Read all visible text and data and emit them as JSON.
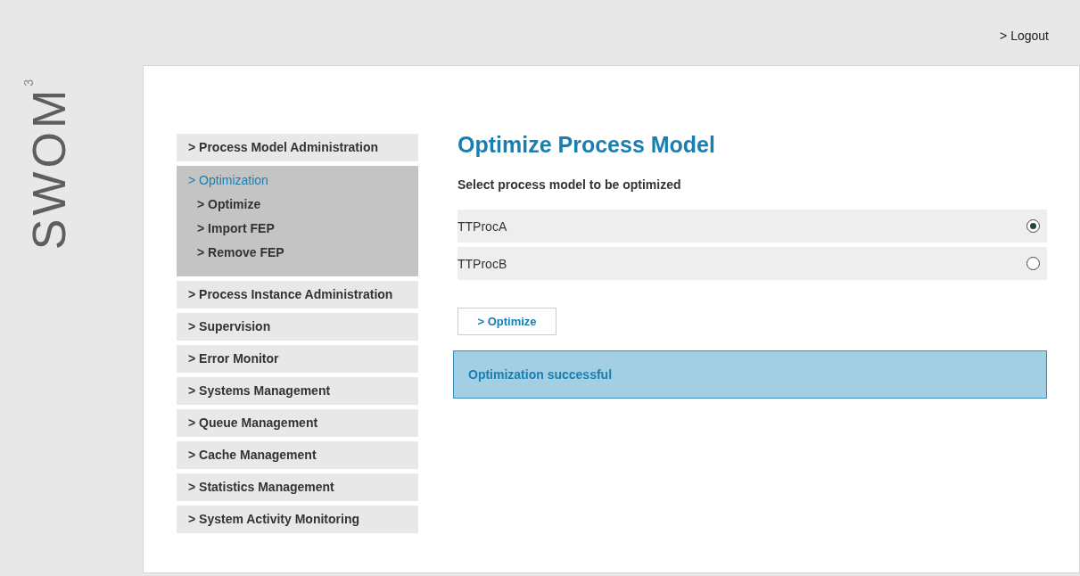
{
  "header": {
    "logout": "> Logout"
  },
  "logo": {
    "text": "SWOM",
    "superscript": "3"
  },
  "sidebar": {
    "items": [
      {
        "label": "> Process Model Administration",
        "expanded": false
      },
      {
        "label": "> Optimization",
        "expanded": true,
        "children": [
          {
            "label": "> Optimize"
          },
          {
            "label": "> Import FEP"
          },
          {
            "label": "> Remove FEP"
          }
        ]
      },
      {
        "label": "> Process Instance Administration",
        "expanded": false
      },
      {
        "label": "> Supervision",
        "expanded": false
      },
      {
        "label": "> Error Monitor",
        "expanded": false
      },
      {
        "label": "> Systems Management",
        "expanded": false
      },
      {
        "label": "> Queue Management",
        "expanded": false
      },
      {
        "label": "> Cache Management",
        "expanded": false
      },
      {
        "label": "> Statistics Management",
        "expanded": false
      },
      {
        "label": "> System Activity Monitoring",
        "expanded": false
      }
    ]
  },
  "main": {
    "title": "Optimize Process Model",
    "instruction": "Select process model to be optimized",
    "models": [
      {
        "name": "TTProcA",
        "selected": true
      },
      {
        "name": "TTProcB",
        "selected": false
      }
    ],
    "button": "> Optimize",
    "message": "Optimization successful"
  }
}
